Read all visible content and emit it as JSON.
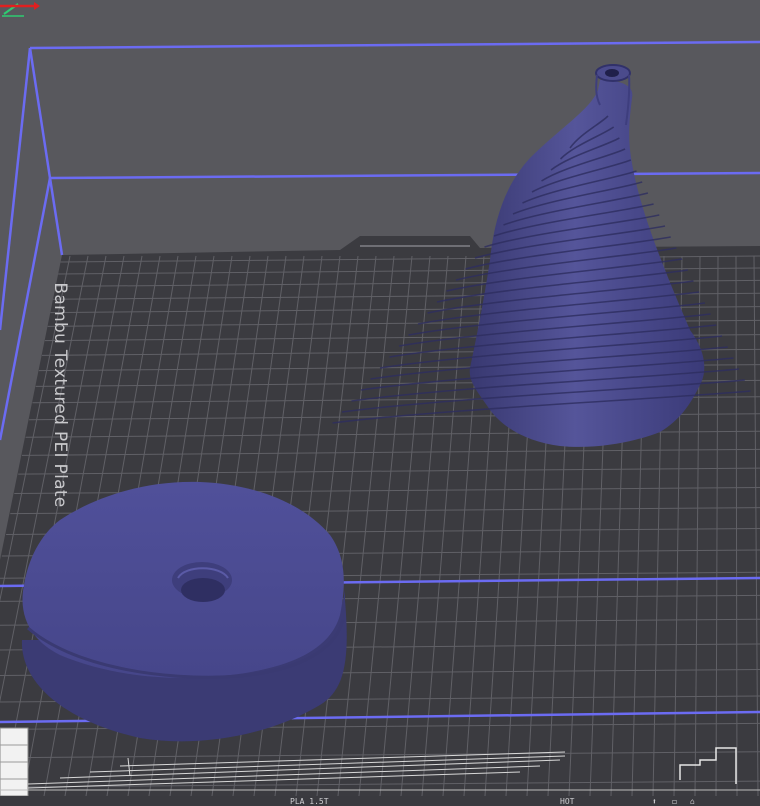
{
  "viewport": {
    "plate_label": "Bambu Textured PEI Plate",
    "colors": {
      "background": "#58585d",
      "plate": "#3b3b40",
      "grid": "#6d6d73",
      "build_volume": "#6b6bf2",
      "model": "#4b4b8c",
      "edit_icon": "#2ecc71",
      "axis_x": "#e02020"
    },
    "icons": {
      "edit": "pencil-icon",
      "axis": "x-axis-arrow-icon",
      "toolbar": [
        "view-icon",
        "cube-icon",
        "home-icon"
      ]
    }
  },
  "bottom_bar": {
    "left_text": "PLA 1.5T",
    "right_text": "HOT"
  }
}
